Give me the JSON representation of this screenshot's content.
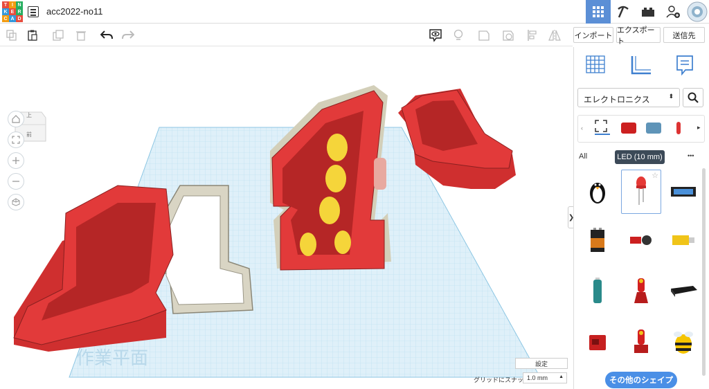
{
  "app": {
    "logo_letters": [
      "T",
      "I",
      "N",
      "K",
      "E",
      "R",
      "C",
      "A",
      "D"
    ],
    "doc_title": "acc2022-no11"
  },
  "toolbar": {
    "import_label": "インポート",
    "export_label": "エクスポート",
    "send_label": "送信先"
  },
  "viewcube": {
    "top_label": "上",
    "front_label": "前"
  },
  "workplane": {
    "label": "作業平面",
    "settings_label": "設定",
    "snap_label": "グリッドにスナップ",
    "snap_value": "1.0 mm"
  },
  "panel": {
    "category": "エレクトロニクス",
    "filter_label": "All",
    "more_dots": "•••",
    "tooltip": "LED (10 mm)",
    "more_shapes_label": "その他のシェイプ",
    "shapes": [
      "penguin",
      "led",
      "breadboard",
      "battery-9v",
      "servo",
      "motor",
      "aa-battery",
      "red-figure",
      "battery-pack",
      "red-block",
      "red-figure-2",
      "bee"
    ]
  },
  "colors": {
    "accent": "#5b8fd6",
    "red": "#d9373a",
    "grid": "#a8d4ec"
  }
}
